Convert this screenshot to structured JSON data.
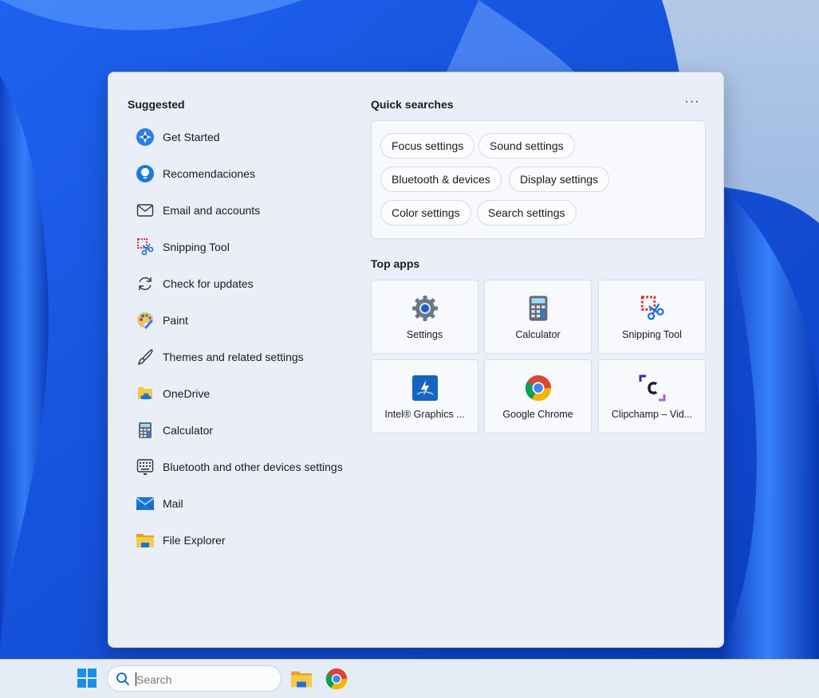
{
  "colors": {
    "wallpaper": "#1a4fd8",
    "panel": "#e9eef8",
    "accent": "#0a5fd1"
  },
  "suggested": {
    "title": "Suggested",
    "items": [
      {
        "label": "Get Started",
        "icon": "get-started-icon"
      },
      {
        "label": "Recomendaciones",
        "icon": "lightbulb-icon"
      },
      {
        "label": "Email and accounts",
        "icon": "envelope-icon"
      },
      {
        "label": "Snipping Tool",
        "icon": "snipping-tool-icon"
      },
      {
        "label": "Check for updates",
        "icon": "refresh-icon"
      },
      {
        "label": "Paint",
        "icon": "paint-icon"
      },
      {
        "label": "Themes and related settings",
        "icon": "brush-icon"
      },
      {
        "label": "OneDrive",
        "icon": "onedrive-icon"
      },
      {
        "label": "Calculator",
        "icon": "calculator-icon"
      },
      {
        "label": "Bluetooth and other devices settings",
        "icon": "keyboard-icon"
      },
      {
        "label": "Mail",
        "icon": "mail-icon"
      },
      {
        "label": "File Explorer",
        "icon": "folder-icon"
      }
    ]
  },
  "quick_searches": {
    "title": "Quick searches",
    "more_label": "···",
    "chips": [
      "Focus settings",
      "Sound settings",
      "Bluetooth & devices",
      "Display settings",
      "Color settings",
      "Search settings"
    ]
  },
  "top_apps": {
    "title": "Top apps",
    "apps": [
      {
        "label": "Settings",
        "icon": "settings-gear-icon"
      },
      {
        "label": "Calculator",
        "icon": "calculator-icon"
      },
      {
        "label": "Snipping Tool",
        "icon": "snipping-tool-icon"
      },
      {
        "label": "Intel® Graphics ...",
        "icon": "intel-graphics-icon"
      },
      {
        "label": "Google Chrome",
        "icon": "chrome-icon"
      },
      {
        "label": "Clipchamp – Vid...",
        "icon": "clipchamp-icon"
      }
    ]
  },
  "taskbar": {
    "search_placeholder": "Search",
    "search_value": ""
  }
}
